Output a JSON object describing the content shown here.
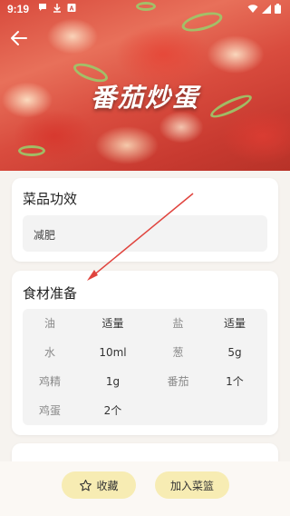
{
  "status_bar": {
    "time": "9:19",
    "icons_left": [
      "chat-bubble-icon",
      "download-icon",
      "a-badge-icon"
    ],
    "icons_right": [
      "wifi-icon",
      "signal-icon",
      "battery-icon"
    ]
  },
  "header": {
    "back_icon": "back-arrow-icon",
    "dish_name": "番茄炒蛋"
  },
  "effect_card": {
    "title": "菜品功效",
    "effect": "减肥"
  },
  "ingredients_card": {
    "title": "食材准备",
    "rows": [
      [
        {
          "name": "油",
          "amount": "适量"
        },
        {
          "name": "盐",
          "amount": "适量"
        }
      ],
      [
        {
          "name": "水",
          "amount": "10ml"
        },
        {
          "name": "葱",
          "amount": "5g"
        }
      ],
      [
        {
          "name": "鸡精",
          "amount": "1g"
        },
        {
          "name": "番茄",
          "amount": "1个"
        }
      ],
      [
        {
          "name": "鸡蛋",
          "amount": "2个"
        }
      ]
    ]
  },
  "bottom_bar": {
    "favorite_label": "收藏",
    "favorite_icon": "star-icon",
    "add_to_basket_label": "加入菜篮"
  },
  "colors": {
    "button_bg": "#f7ecb3",
    "annotation_arrow": "#e0443e",
    "page_bg": "#f6f3ef"
  }
}
